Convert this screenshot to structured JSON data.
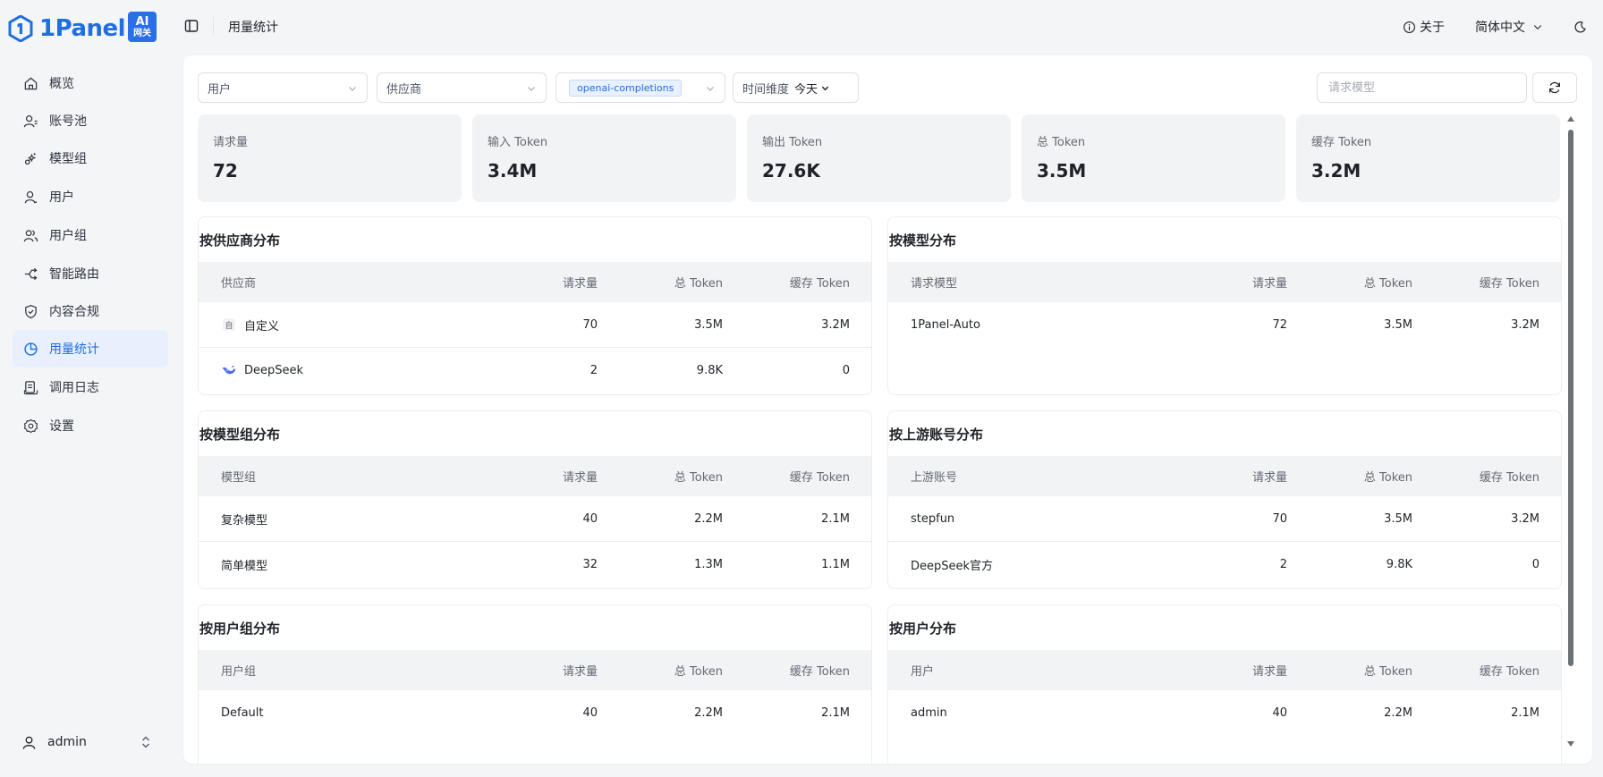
{
  "brand": {
    "name": "1Panel",
    "badge_top": "AI",
    "badge_bottom": "网关",
    "color": "#1f6fe0"
  },
  "header": {
    "title": "用量统计",
    "about": "关于",
    "language": "简体中文"
  },
  "sidebar": {
    "items": [
      {
        "label": "概览",
        "icon": "home-icon"
      },
      {
        "label": "账号池",
        "icon": "account-pool-icon"
      },
      {
        "label": "模型组",
        "icon": "model-group-icon"
      },
      {
        "label": "用户",
        "icon": "user-icon"
      },
      {
        "label": "用户组",
        "icon": "user-group-icon"
      },
      {
        "label": "智能路由",
        "icon": "route-icon"
      },
      {
        "label": "内容合规",
        "icon": "shield-icon"
      },
      {
        "label": "用量统计",
        "icon": "pie-chart-icon",
        "active": true
      },
      {
        "label": "调用日志",
        "icon": "log-icon"
      },
      {
        "label": "设置",
        "icon": "gear-icon"
      }
    ],
    "user": "admin"
  },
  "filters": {
    "user": "用户",
    "provider": "供应商",
    "endpoint_chip": "openai-completions",
    "time_label": "时间维度",
    "time_value": "今天",
    "search_placeholder": "请求模型"
  },
  "stats": [
    {
      "label": "请求量",
      "value": "72"
    },
    {
      "label": "输入 Token",
      "value": "3.4M"
    },
    {
      "label": "输出 Token",
      "value": "27.6K"
    },
    {
      "label": "总 Token",
      "value": "3.5M"
    },
    {
      "label": "缓存 Token",
      "value": "3.2M"
    }
  ],
  "panels": {
    "by_provider": {
      "title": "按供应商分布",
      "headers": [
        "供应商",
        "请求量",
        "总 Token",
        "缓存 Token"
      ],
      "rows": [
        {
          "name": "自定义",
          "icon": "custom-provider-icon",
          "requests": "70",
          "total": "3.5M",
          "cache": "3.2M"
        },
        {
          "name": "DeepSeek",
          "icon": "deepseek-whale-icon",
          "requests": "2",
          "total": "9.8K",
          "cache": "0"
        }
      ]
    },
    "by_model": {
      "title": "按模型分布",
      "headers": [
        "请求模型",
        "请求量",
        "总 Token",
        "缓存 Token"
      ],
      "rows": [
        {
          "name": "1Panel-Auto",
          "requests": "72",
          "total": "3.5M",
          "cache": "3.2M"
        }
      ]
    },
    "by_model_group": {
      "title": "按模型组分布",
      "headers": [
        "模型组",
        "请求量",
        "总 Token",
        "缓存 Token"
      ],
      "rows": [
        {
          "name": "复杂模型",
          "requests": "40",
          "total": "2.2M",
          "cache": "2.1M"
        },
        {
          "name": "简单模型",
          "requests": "32",
          "total": "1.3M",
          "cache": "1.1M"
        }
      ]
    },
    "by_upstream": {
      "title": "按上游账号分布",
      "headers": [
        "上游账号",
        "请求量",
        "总 Token",
        "缓存 Token"
      ],
      "rows": [
        {
          "name": "stepfun",
          "requests": "70",
          "total": "3.5M",
          "cache": "3.2M"
        },
        {
          "name": "DeepSeek官方",
          "requests": "2",
          "total": "9.8K",
          "cache": "0"
        }
      ]
    },
    "by_user_group": {
      "title": "按用户组分布",
      "headers": [
        "用户组",
        "请求量",
        "总 Token",
        "缓存 Token"
      ],
      "rows": [
        {
          "name": "Default",
          "requests": "40",
          "total": "2.2M",
          "cache": "2.1M"
        }
      ]
    },
    "by_user": {
      "title": "按用户分布",
      "headers": [
        "用户",
        "请求量",
        "总 Token",
        "缓存 Token"
      ],
      "rows": [
        {
          "name": "admin",
          "requests": "40",
          "total": "2.2M",
          "cache": "2.1M"
        }
      ]
    }
  }
}
